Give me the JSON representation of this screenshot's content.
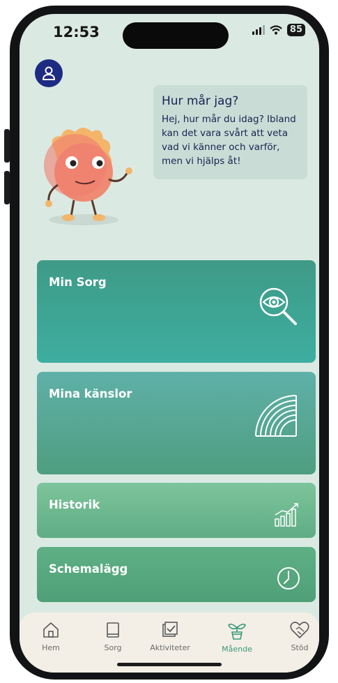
{
  "status": {
    "time": "12:53",
    "battery": "85"
  },
  "bubble": {
    "title": "Hur mår jag?",
    "text": "Hej, hur mår du idag? Ibland kan det vara svårt att veta vad vi känner och varför, men vi hjälps åt!"
  },
  "cards": [
    {
      "label": "Min Sorg",
      "icon": "eye-search-icon"
    },
    {
      "label": "Mina känslor",
      "icon": "rainbow-icon"
    },
    {
      "label": "Historik",
      "icon": "chart-icon"
    },
    {
      "label": "Schemalägg",
      "icon": "clock-icon"
    }
  ],
  "tabs": [
    {
      "label": "Hem",
      "icon": "home-icon"
    },
    {
      "label": "Sorg",
      "icon": "book-icon"
    },
    {
      "label": "Aktiviteter",
      "icon": "checklist-icon"
    },
    {
      "label": "Mående",
      "icon": "plant-icon",
      "active": true
    },
    {
      "label": "Stöd",
      "icon": "heart-handshake-icon"
    }
  ],
  "colors": {
    "accent": "#3a9a78",
    "avatar": "#1d2b82",
    "text_dark": "#1c2150"
  }
}
